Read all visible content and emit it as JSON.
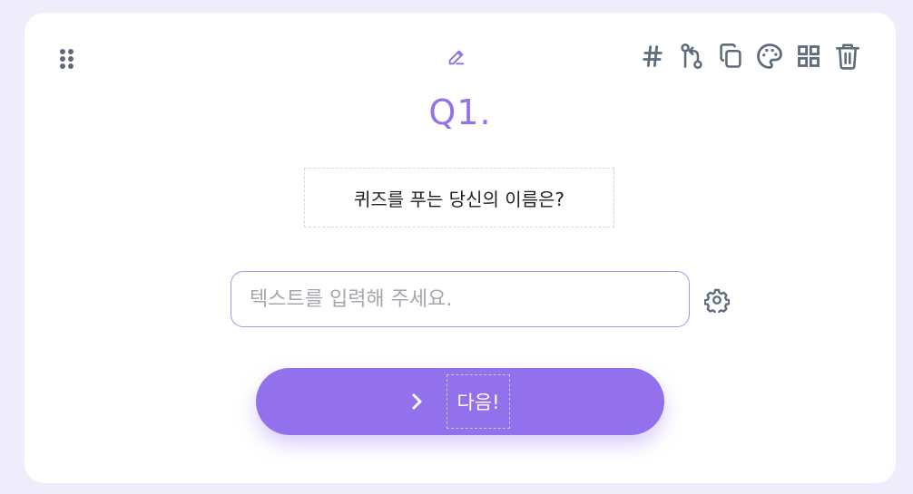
{
  "card": {
    "question_number": "Q1.",
    "question_text": "퀴즈를 푸는 당신의 이름은?",
    "answer_input": {
      "placeholder": "텍스트를 입력해 주세요.",
      "value": ""
    },
    "next_button_label": "다음!"
  },
  "toolbar": {
    "icons": [
      "hash-icon",
      "branch-icon",
      "duplicate-icon",
      "palette-icon",
      "grid-icon",
      "trash-icon"
    ]
  },
  "colors": {
    "accent": "#9371ed",
    "icon": "#5f6b7a",
    "background": "#efedfb",
    "card": "#ffffff"
  }
}
